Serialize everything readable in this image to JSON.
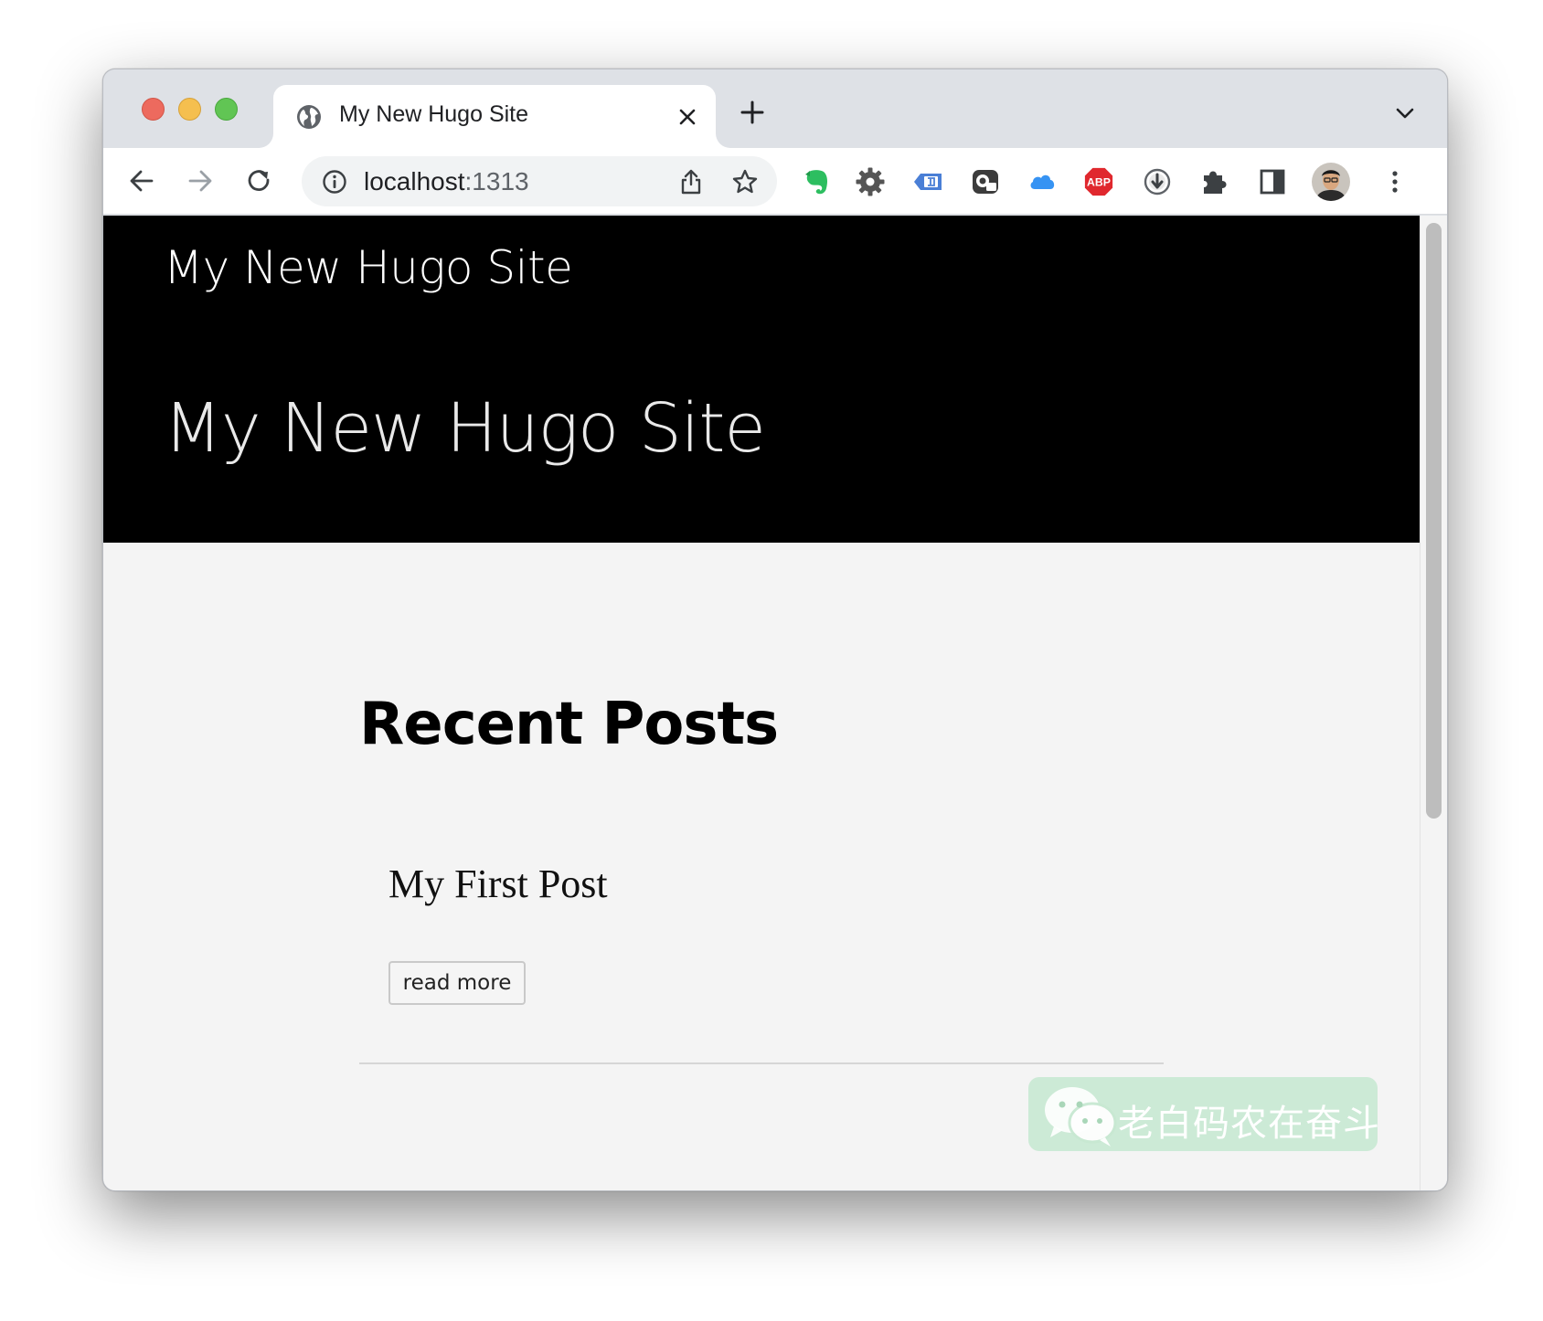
{
  "browser": {
    "tab": {
      "title": "My New Hugo Site"
    },
    "address": {
      "host": "localhost",
      "port": ":1313"
    },
    "extensions": [
      "evernote-icon",
      "gear-extension-icon",
      "tag-extension-icon",
      "screen-extension-icon",
      "icloud-icon",
      "adblock-plus-icon",
      "download-extension-icon",
      "puzzle-icon",
      "side-panel-icon",
      "avatar",
      "kebab-menu-icon"
    ],
    "adblock_label": "ABP",
    "colors": {
      "tabstrip": "#dee1e6",
      "evernote": "#2dbe60",
      "adblock": "#e0282e",
      "icloud": "#3693f3",
      "tag": "#4a7fd6"
    }
  },
  "page": {
    "site_name": "My New Hugo Site",
    "hero_title": "My New Hugo Site",
    "section_title": "Recent Posts",
    "posts": [
      {
        "title": "My First Post",
        "read_more": "read more"
      }
    ]
  },
  "watermark": {
    "text": "老白码农在奋斗"
  }
}
